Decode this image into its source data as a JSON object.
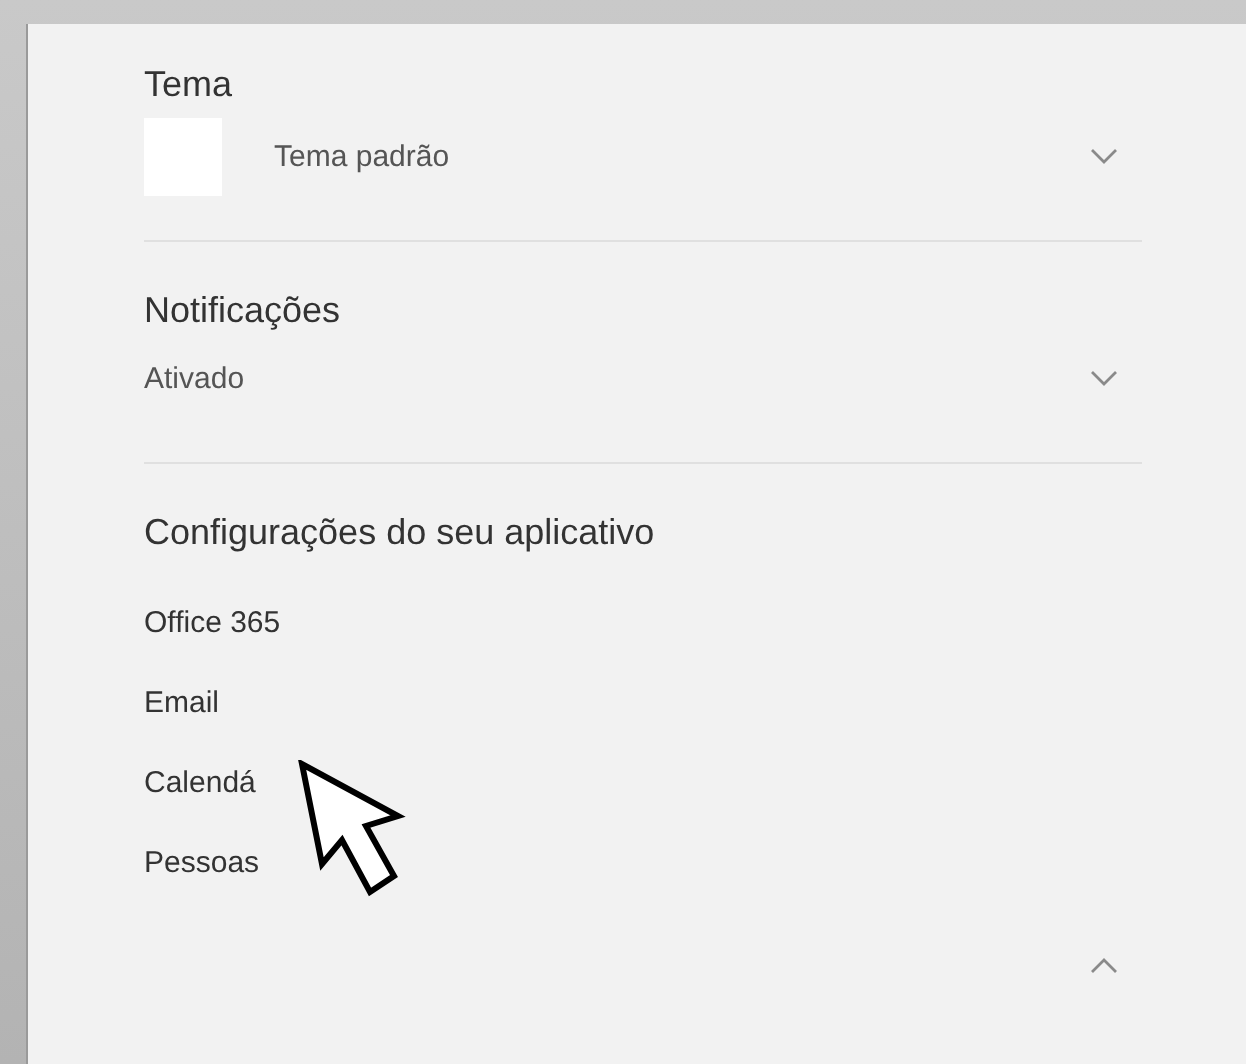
{
  "sections": [
    {
      "kind": "select",
      "title": "Tema",
      "value": "Tema padrão",
      "color": "#ffffff"
    },
    {
      "kind": "select",
      "title": "Notificações",
      "value": "Ativado"
    },
    {
      "kind": "links",
      "title": "Configurações do seu aplicativo",
      "expanded": true,
      "items": [
        "Office 365",
        "Email",
        "Calendá",
        "Pessoas"
      ]
    }
  ]
}
